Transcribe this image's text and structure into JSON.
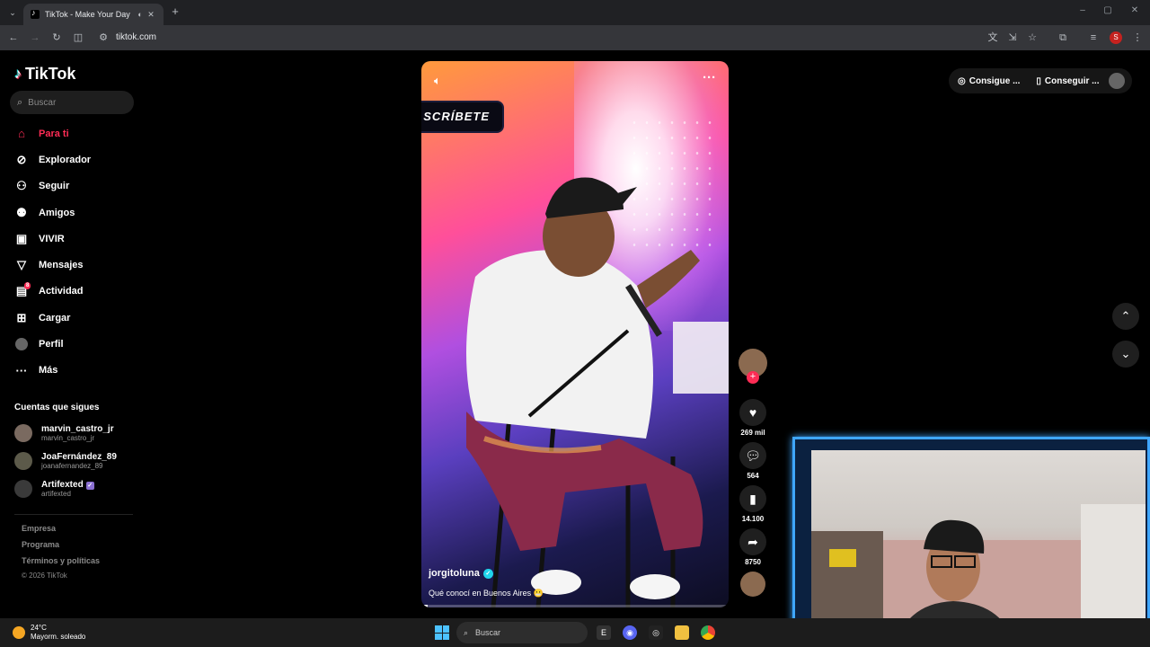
{
  "browser": {
    "tab_title": "TikTok - Make Your Day",
    "url": "tiktok.com",
    "profile_initial": "S"
  },
  "sidebar": {
    "logo": "TikTok",
    "search_placeholder": "Buscar",
    "nav": [
      {
        "label": "Para ti",
        "icon": "home-icon",
        "active": true
      },
      {
        "label": "Explorador",
        "icon": "compass-icon"
      },
      {
        "label": "Seguir",
        "icon": "follow-icon"
      },
      {
        "label": "Amigos",
        "icon": "friends-icon"
      },
      {
        "label": "VIVIR",
        "icon": "live-icon"
      },
      {
        "label": "Mensajes",
        "icon": "messages-icon"
      },
      {
        "label": "Actividad",
        "icon": "activity-icon",
        "badge": "8"
      },
      {
        "label": "Cargar",
        "icon": "upload-icon"
      },
      {
        "label": "Perfil",
        "icon": "profile-icon"
      },
      {
        "label": "Más",
        "icon": "more-icon"
      }
    ],
    "following_title": "Cuentas que sigues",
    "following": [
      {
        "name": "marvin_castro_jr",
        "handle": "marvin_castro_jr"
      },
      {
        "name": "JoaFernández_89",
        "handle": "joanafernandez_89"
      },
      {
        "name": "Artifexted",
        "handle": "artifexted",
        "verified": true
      }
    ],
    "footer_links": [
      "Empresa",
      "Programa",
      "Términos y políticas"
    ],
    "copyright": "© 2026 TikTok"
  },
  "video": {
    "banner_text": "SCRÍBETE",
    "username": "jorgitoluna",
    "description": "Qué conocí en Buenos Aires 😬",
    "progress": 0.02
  },
  "actions": {
    "likes": "269 mil",
    "comments": "564",
    "saves": "14.100",
    "shares": "8750"
  },
  "topbar": {
    "btn1": "Consigue ...",
    "btn2": "Conseguir ..."
  },
  "taskbar": {
    "temp": "24°C",
    "weather": "Mayorm. soleado",
    "search_placeholder": "Buscar"
  }
}
